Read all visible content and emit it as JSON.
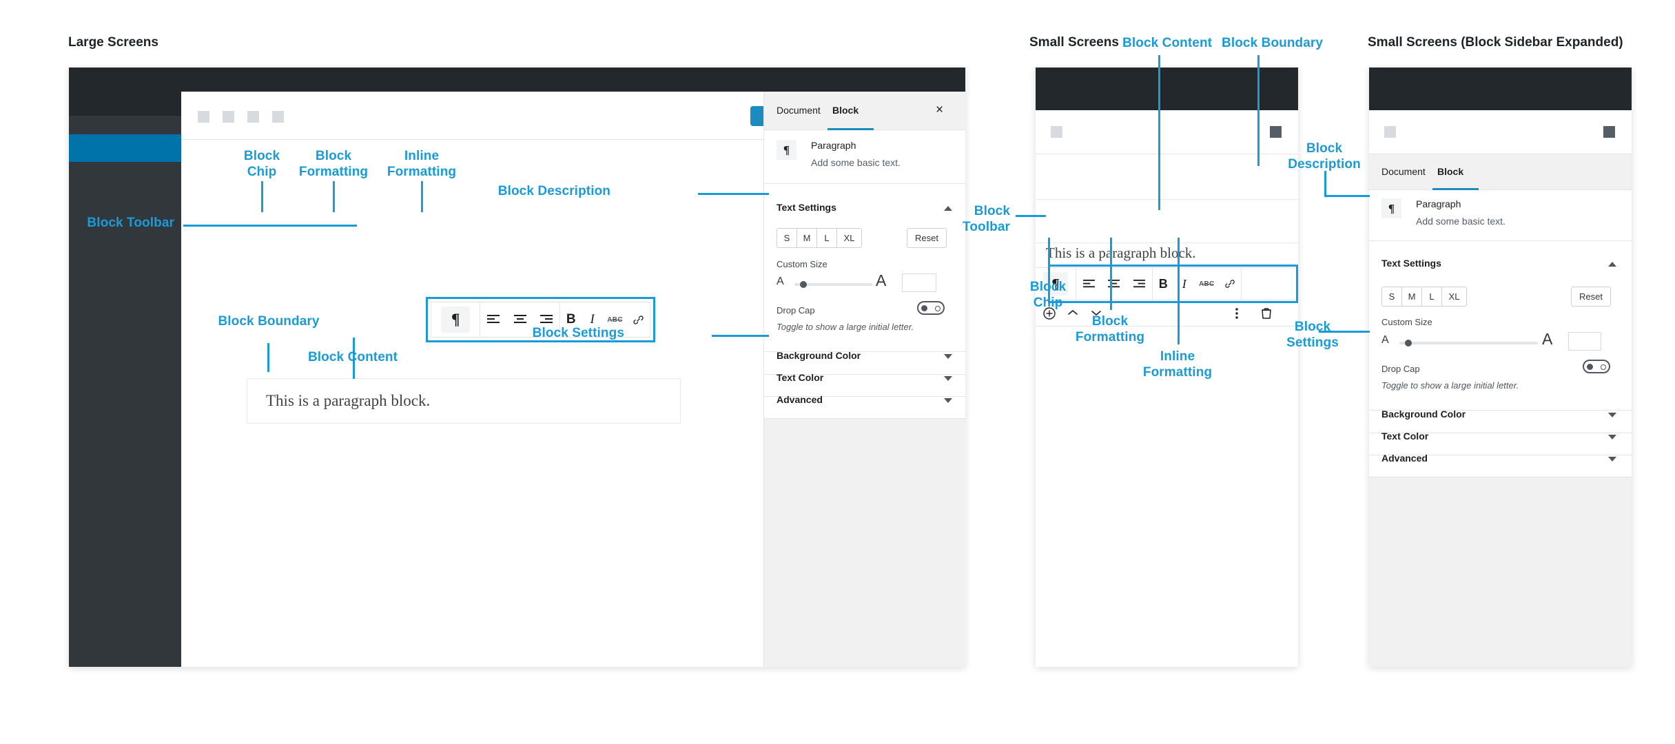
{
  "sections": {
    "large": "Large Screens",
    "small": "Small Screens",
    "small_expanded": "Small Screens (Block Sidebar Expanded)"
  },
  "annotations": {
    "block_chip": "Block\nChip",
    "block_formatting": "Block\nFormatting",
    "inline_formatting": "Inline\nFormatting",
    "block_toolbar": "Block Toolbar",
    "block_toolbar_wrapped": "Block\nToolbar",
    "block_boundary": "Block Boundary",
    "block_content": "Block Content",
    "block_description": "Block Description",
    "block_description_wrapped": "Block\nDescription",
    "block_settings": "Block Settings",
    "block_settings_wrapped": "Block\nSettings"
  },
  "editor": {
    "paragraph_text": "This is a paragraph block.",
    "toolbar": {
      "chip": {
        "label": "¶",
        "icon": "paragraph-icon"
      },
      "align_left": "align-left-icon",
      "align_center": "align-center-icon",
      "align_right": "align-right-icon",
      "bold": "B",
      "italic": "I",
      "strikethrough": "ABC",
      "link": "link-icon"
    },
    "secondary_toolbar": {
      "add": "add-block-icon",
      "move_up": "chevron-up-icon",
      "move_down": "chevron-down-icon",
      "more": "kebab-menu-icon",
      "delete": "trash-icon"
    }
  },
  "sidebar": {
    "tabs": [
      {
        "label": "Document",
        "active": false
      },
      {
        "label": "Block",
        "active": true
      }
    ],
    "close": "×",
    "block": {
      "icon": "¶",
      "name": "Paragraph",
      "description": "Add some basic text."
    },
    "text_settings": {
      "title": "Text Settings",
      "sizes": [
        "S",
        "M",
        "L",
        "XL"
      ],
      "reset": "Reset",
      "custom_size_label": "Custom Size",
      "small_a": "A",
      "large_a": "A",
      "custom_size_value": "",
      "drop_cap_label": "Drop Cap",
      "drop_cap_help": "Toggle to show a large initial letter.",
      "drop_cap_on": false
    },
    "panels": [
      {
        "label": "Background Color",
        "expanded": false
      },
      {
        "label": "Text Color",
        "expanded": false
      },
      {
        "label": "Advanced",
        "expanded": false
      }
    ]
  },
  "colors": {
    "accent": "#1a9bd7",
    "admin_bar": "#23282d",
    "admin_menu": "#32373c",
    "admin_menu_current": "#0073aa",
    "publish_button": "#1b8cbe",
    "tab_underline": "#1b8cbe",
    "border": "#e2e4e7",
    "panel_bg": "#f1f1f1"
  }
}
